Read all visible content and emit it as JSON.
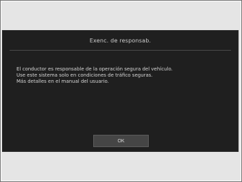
{
  "dialog": {
    "title": "Exenc. de responsab.",
    "paragraphs": [
      "El conductor es responsable de la operación segura del vehículo.",
      "Use este sistema solo en condiciones de tráfico seguras.",
      "Más detalles en el manual del usuario."
    ],
    "ok_label": "OK"
  }
}
